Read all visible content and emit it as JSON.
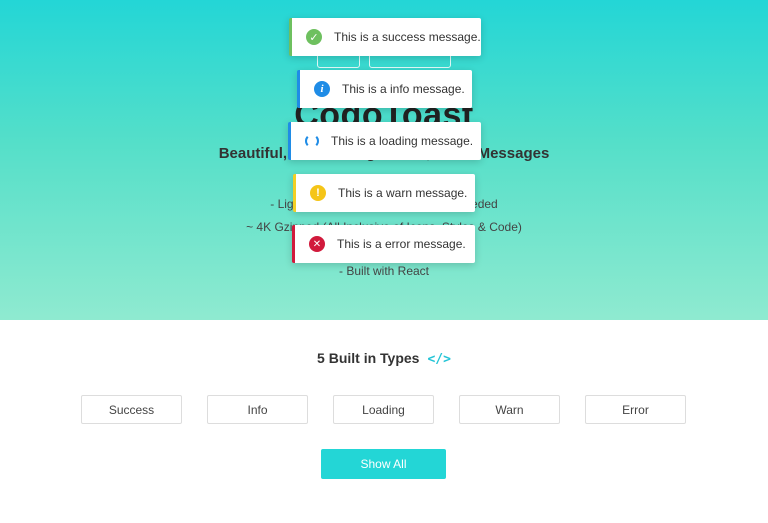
{
  "hero": {
    "title": "CogoToast",
    "subtitle": "Beautiful, Zero Configuration, Toast Messages",
    "lines": [
      "- Lightweight & Zero Configuration Needed",
      "~ 4K Gzipped (All Inclusive of Icons, Styles & Code)",
      "- Built with React"
    ]
  },
  "toasts": [
    {
      "type": "success",
      "icon": "check-icon",
      "glyph": "✓",
      "message": "This is a success message.",
      "color": "#6ec05f"
    },
    {
      "type": "info",
      "icon": "info-icon",
      "glyph": "i",
      "message": "This is a info message.",
      "color": "#1f8ce6"
    },
    {
      "type": "loading",
      "icon": "loading-spinner-icon",
      "glyph": "",
      "message": "This is a loading message.",
      "color": "#1f8ce6"
    },
    {
      "type": "warn",
      "icon": "warning-icon",
      "glyph": "!",
      "message": "This is a warn message.",
      "color": "#f5c518"
    },
    {
      "type": "error",
      "icon": "error-x-icon",
      "glyph": "✕",
      "message": "This is a error message.",
      "color": "#d11a3c"
    }
  ],
  "types_section": {
    "title": "5 Built in Types",
    "code_icon": "</>",
    "buttons": [
      "Success",
      "Info",
      "Loading",
      "Warn",
      "Error"
    ],
    "show_all": "Show All"
  },
  "colors": {
    "accent": "#23d6d6",
    "gradient_bottom": "#8fead0"
  }
}
